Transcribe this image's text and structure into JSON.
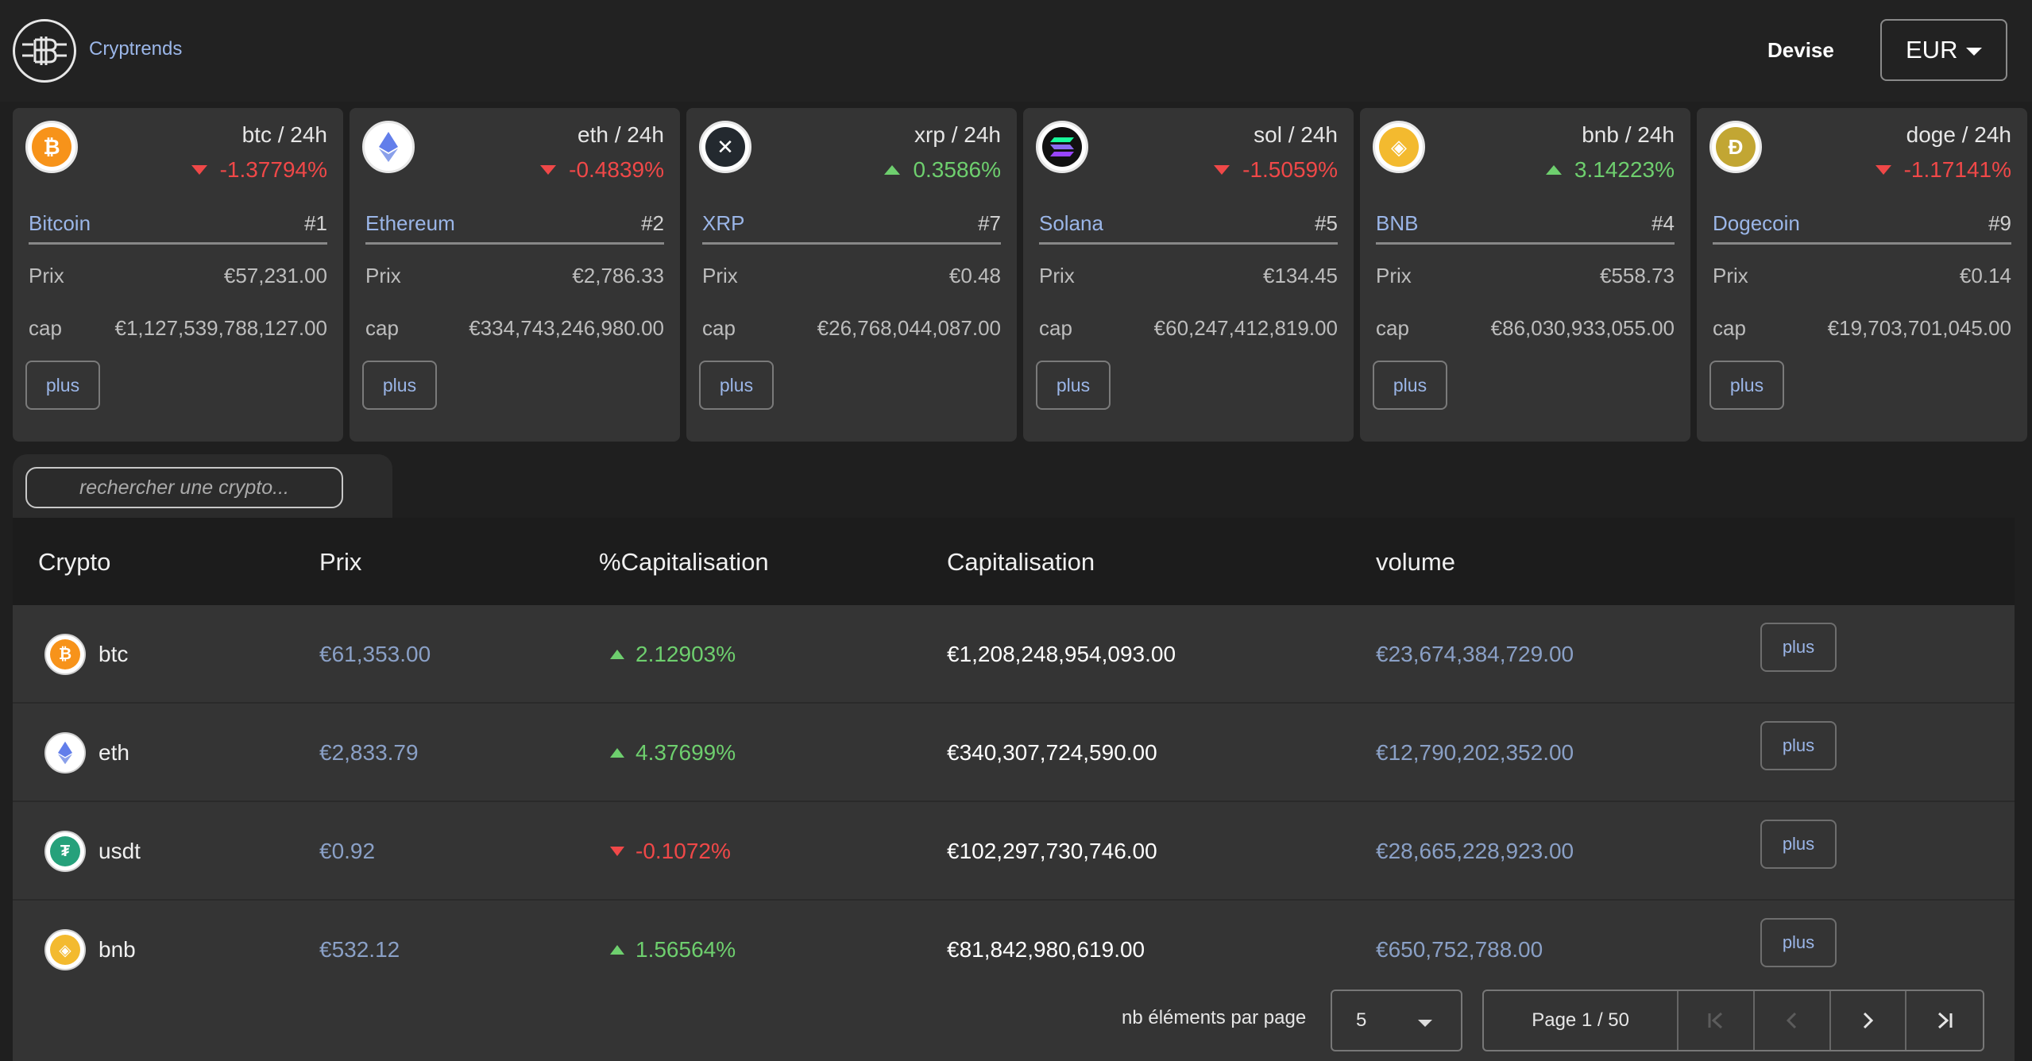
{
  "header": {
    "brand": "Cryptrends",
    "devise_label": "Devise",
    "currency": "EUR"
  },
  "cards": [
    {
      "symbol_title": "btc / 24h",
      "change": "-1.37794%",
      "direction": "down",
      "name": "Bitcoin",
      "rank": "#1",
      "prix_label": "Prix",
      "prix": "€57,231.00",
      "cap_label": "cap",
      "cap": "€1,127,539,788,127.00",
      "button": "plus",
      "icon": "bitcoin-icon",
      "icon_char": "₿",
      "icon_color": "#f7931a"
    },
    {
      "symbol_title": "eth / 24h",
      "change": "-0.4839%",
      "direction": "down",
      "name": "Ethereum",
      "rank": "#2",
      "prix_label": "Prix",
      "prix": "€2,786.33",
      "cap_label": "cap",
      "cap": "€334,743,246,980.00",
      "button": "plus",
      "icon": "ethereum-icon",
      "icon_char": "◆",
      "icon_color": "#627eea"
    },
    {
      "symbol_title": "xrp / 24h",
      "change": "0.3586%",
      "direction": "up",
      "name": "XRP",
      "rank": "#7",
      "prix_label": "Prix",
      "prix": "€0.48",
      "cap_label": "cap",
      "cap": "€26,768,044,087.00",
      "button": "plus",
      "icon": "xrp-icon",
      "icon_char": "✕",
      "icon_color": "#23292f"
    },
    {
      "symbol_title": "sol / 24h",
      "change": "-1.5059%",
      "direction": "down",
      "name": "Solana",
      "rank": "#5",
      "prix_label": "Prix",
      "prix": "€134.45",
      "cap_label": "cap",
      "cap": "€60,247,412,819.00",
      "button": "plus",
      "icon": "solana-icon",
      "icon_char": "≡",
      "icon_color": "#111111"
    },
    {
      "symbol_title": "bnb / 24h",
      "change": "3.14223%",
      "direction": "up",
      "name": "BNB",
      "rank": "#4",
      "prix_label": "Prix",
      "prix": "€558.73",
      "cap_label": "cap",
      "cap": "€86,030,933,055.00",
      "button": "plus",
      "icon": "bnb-icon",
      "icon_char": "◈",
      "icon_color": "#f3ba2f"
    },
    {
      "symbol_title": "doge / 24h",
      "change": "-1.17141%",
      "direction": "down",
      "name": "Dogecoin",
      "rank": "#9",
      "prix_label": "Prix",
      "prix": "€0.14",
      "cap_label": "cap",
      "cap": "€19,703,701,045.00",
      "button": "plus",
      "icon": "dogecoin-icon",
      "icon_char": "Ð",
      "icon_color": "#c2a633"
    }
  ],
  "search": {
    "placeholder": "rechercher une crypto..."
  },
  "table": {
    "headers": [
      "Crypto",
      "Prix",
      "%Capitalisation",
      "Capitalisation",
      "volume"
    ],
    "rows": [
      {
        "symbol": "btc",
        "prix": "€61,353.00",
        "pct": "2.12903%",
        "direction": "up",
        "cap": "€1,208,248,954,093.00",
        "volume": "€23,674,384,729.00",
        "button": "plus",
        "icon": "bitcoin-icon",
        "icon_char": "₿",
        "icon_color": "#f7931a"
      },
      {
        "symbol": "eth",
        "prix": "€2,833.79",
        "pct": "4.37699%",
        "direction": "up",
        "cap": "€340,307,724,590.00",
        "volume": "€12,790,202,352.00",
        "button": "plus",
        "icon": "ethereum-icon",
        "icon_char": "◆",
        "icon_color": "#627eea"
      },
      {
        "symbol": "usdt",
        "prix": "€0.92",
        "pct": "-0.1072%",
        "direction": "down",
        "cap": "€102,297,730,746.00",
        "volume": "€28,665,228,923.00",
        "button": "plus",
        "icon": "tether-icon",
        "icon_char": "₮",
        "icon_color": "#26a17b"
      },
      {
        "symbol": "bnb",
        "prix": "€532.12",
        "pct": "1.56564%",
        "direction": "up",
        "cap": "€81,842,980,619.00",
        "volume": "€650,752,788.00",
        "button": "plus",
        "icon": "bnb-icon",
        "icon_char": "◈",
        "icon_color": "#f3ba2f"
      }
    ]
  },
  "pagination": {
    "per_page_label": "nb éléments par page",
    "per_page": "5",
    "page_info": "Page 1 / 50"
  },
  "colors": {
    "up": "#6ecf6e",
    "down": "#f04848",
    "accent": "#9bb6e8"
  }
}
